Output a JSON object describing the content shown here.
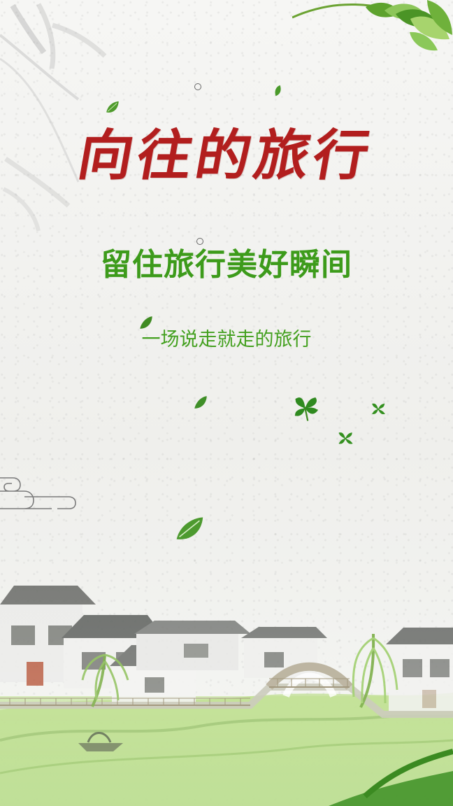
{
  "poster": {
    "title": "向往的旅行",
    "subtitle": "留住旅行美好瞬间",
    "tagline": "一场说走就走的旅行"
  },
  "decorations": {
    "icons": [
      "bamboo-branch-icon",
      "green-leaves-icon",
      "cloud-scroll-icon",
      "village-landscape-illustration",
      "falling-leaf-icon"
    ],
    "colors": {
      "title": "#b21e1e",
      "subtitle": "#3d9b1b",
      "tagline": "#43a01f",
      "background": "#f3f3f1"
    }
  }
}
